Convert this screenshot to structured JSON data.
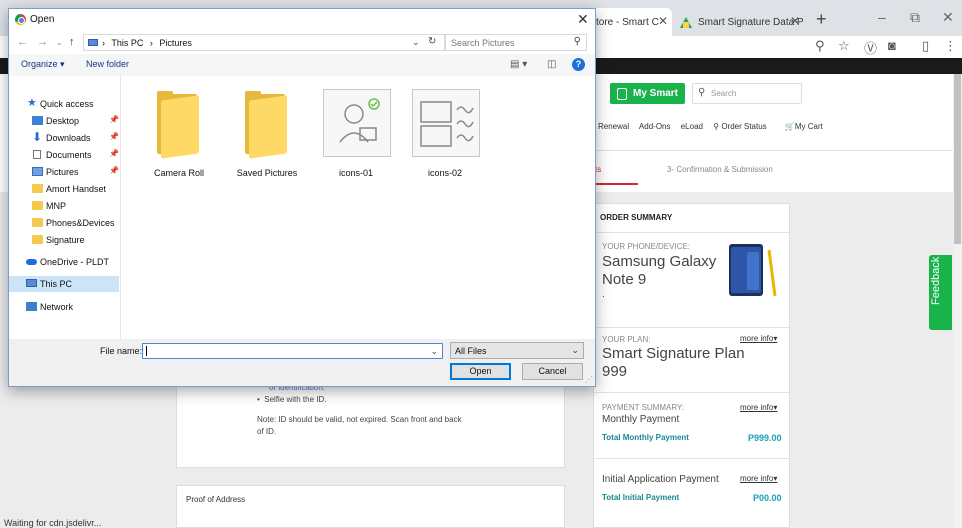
{
  "browser": {
    "tabs": [
      {
        "title": "tore - Smart C",
        "active": true
      },
      {
        "title": "Smart Signature Data P",
        "active": false
      }
    ],
    "new_tab": "+",
    "window_controls": {
      "minimize": "–",
      "maximize": "⧉",
      "close": "✕"
    },
    "toolbar_icons": [
      "zoom-icon",
      "star-icon",
      "v-extension-icon",
      "camera-icon",
      "extension-icon",
      "menu-icon"
    ]
  },
  "website": {
    "my_smart_label": "My Smart",
    "search_placeholder": "Search",
    "nav_links": [
      "Renewal",
      "Add-Ons",
      "eLoad",
      "Order Status",
      "My Cart"
    ],
    "steps": {
      "current_fragment": "ts",
      "next": "3- Confirmation & Submission"
    },
    "requirements": {
      "faint_text": "or identification.",
      "bullet": "Selfie with the ID.",
      "note": "Note: ID should be valid, not expired. Scan front and back of ID."
    },
    "proof_of_address": "Proof of Address",
    "status_text": "Waiting for cdn.jsdelivr...",
    "order_summary": {
      "title": "ORDER SUMMARY",
      "phone_label": "YOUR PHONE/DEVICE:",
      "phone_name": "Samsung Galaxy Note 9",
      "phone_sub": ".",
      "plan_label": "YOUR PLAN:",
      "plan_name": "Smart Signature Plan 999",
      "more_info": "more info",
      "payment_label": "PAYMENT SUMMARY:",
      "monthly_payment": "Monthly Payment",
      "total_monthly_label": "Total Monthly Payment",
      "total_monthly_value": "P999.00",
      "initial_payment": "Initial Application Payment",
      "total_initial_label": "Total Initial Payment",
      "total_initial_value": "P00.00"
    },
    "feedback": "Feedback"
  },
  "dialog": {
    "title": "Open",
    "breadcrumb": [
      "This PC",
      "Pictures"
    ],
    "search_placeholder": "Search Pictures",
    "organize": "Organize ▾",
    "new_folder": "New folder",
    "help": "?",
    "nav_items": [
      {
        "label": "Quick access",
        "icon": "star"
      },
      {
        "label": "Desktop",
        "icon": "desktop",
        "pinned": true
      },
      {
        "label": "Downloads",
        "icon": "download",
        "pinned": true
      },
      {
        "label": "Documents",
        "icon": "document",
        "pinned": true
      },
      {
        "label": "Pictures",
        "icon": "pictures",
        "pinned": true
      },
      {
        "label": "Amort Handset",
        "icon": "folder"
      },
      {
        "label": "MNP",
        "icon": "folder"
      },
      {
        "label": "Phones&Devices",
        "icon": "folder"
      },
      {
        "label": "Signature",
        "icon": "folder"
      },
      {
        "label": "OneDrive - PLDT",
        "icon": "cloud"
      },
      {
        "label": "This PC",
        "icon": "pc",
        "selected": true
      },
      {
        "label": "Network",
        "icon": "network"
      }
    ],
    "files": [
      {
        "name": "Camera Roll",
        "type": "folder"
      },
      {
        "name": "Saved Pictures",
        "type": "folder"
      },
      {
        "name": "icons-01",
        "type": "image"
      },
      {
        "name": "icons-02",
        "type": "image"
      }
    ],
    "file_name_label": "File name:",
    "file_name_value": "",
    "file_type": "All Files",
    "open_button": "Open",
    "cancel_button": "Cancel"
  }
}
